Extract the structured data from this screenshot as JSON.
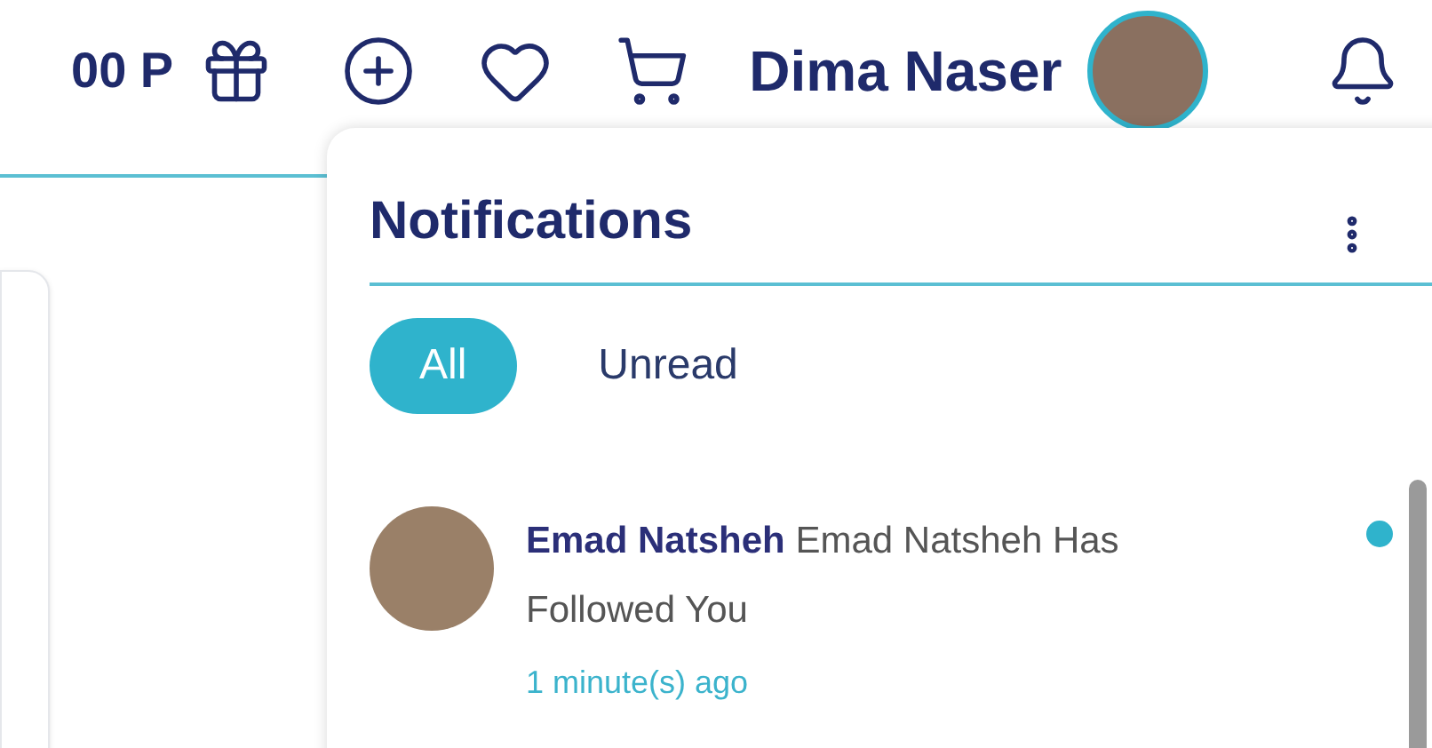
{
  "header": {
    "points": "00 P",
    "user_name": "Dima Naser"
  },
  "notifications": {
    "title": "Notifications",
    "tabs": [
      {
        "label": "All",
        "selected": true
      },
      {
        "label": "Unread",
        "selected": false
      }
    ],
    "items": [
      {
        "message": "**Emad Natsheh** Emad Natsheh Has Followed You",
        "time": "1 minute(s) ago",
        "unread": true
      }
    ]
  }
}
